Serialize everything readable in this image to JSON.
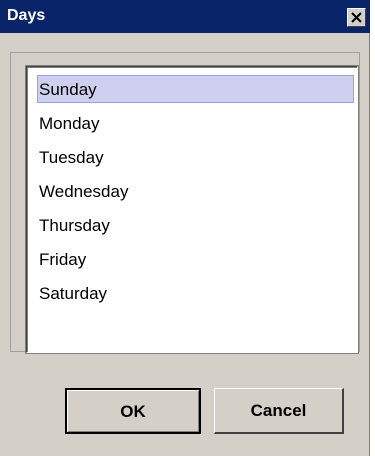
{
  "window": {
    "title": "Days",
    "close_icon": "close-icon"
  },
  "list": {
    "items": [
      {
        "label": "Sunday",
        "selected": true
      },
      {
        "label": "Monday",
        "selected": false
      },
      {
        "label": "Tuesday",
        "selected": false
      },
      {
        "label": "Wednesday",
        "selected": false
      },
      {
        "label": "Thursday",
        "selected": false
      },
      {
        "label": "Friday",
        "selected": false
      },
      {
        "label": "Saturday",
        "selected": false
      }
    ]
  },
  "buttons": {
    "ok_label": "OK",
    "cancel_label": "Cancel"
  },
  "colors": {
    "titlebar": "#0a246a",
    "window_bg": "#d4d0c8",
    "selection_bg": "#cfd0ef"
  }
}
